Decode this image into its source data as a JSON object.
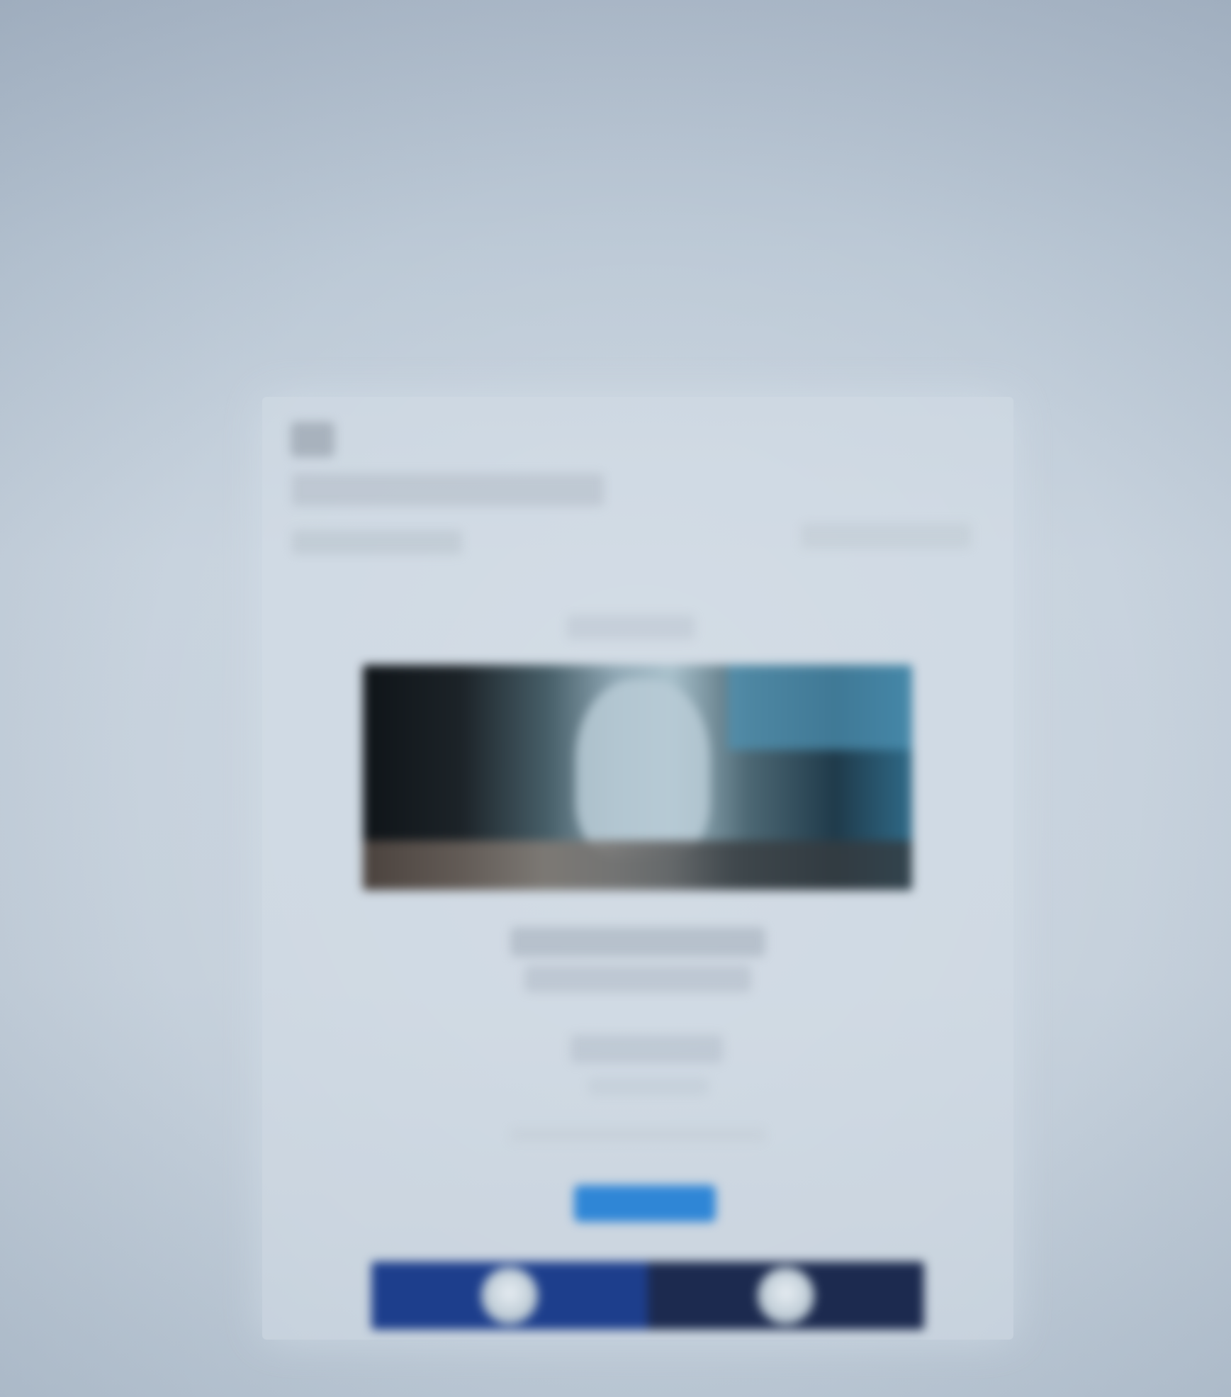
{
  "email": {
    "sender_name": "",
    "sender_email": "",
    "sent_date": "",
    "preheader": "",
    "headline": "",
    "body_text": "",
    "fine_print": "",
    "cta_label": ""
  },
  "social": {
    "left_icon": "facebook-icon",
    "right_icon": "twitter-icon",
    "left_glyph": "",
    "right_glyph": ""
  },
  "colors": {
    "background": "#c2cdd9",
    "cta": "#2f86d6",
    "social_left": "#1d3e8c",
    "social_right": "#1c2a4f"
  }
}
